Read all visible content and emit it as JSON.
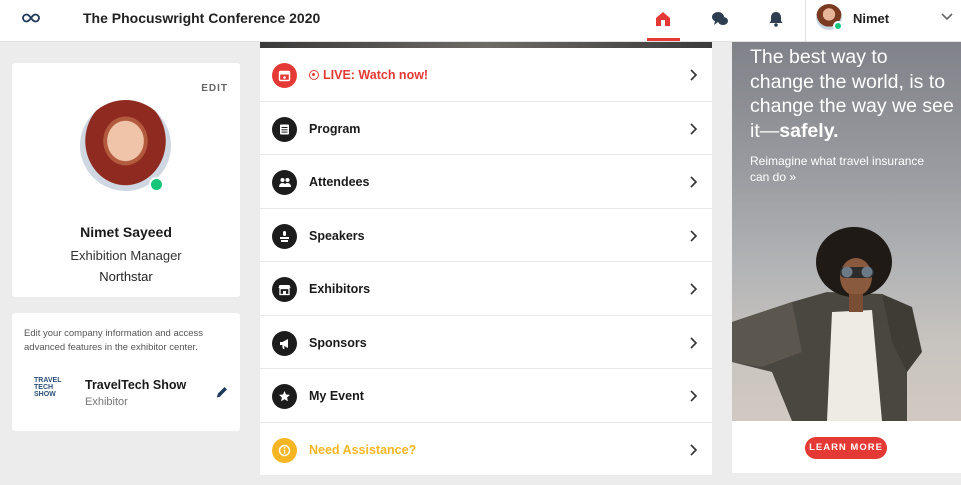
{
  "header": {
    "title": "The Phocuswright Conference 2020",
    "logo_icon": "infinity-logo-icon",
    "nav": [
      {
        "name": "home",
        "icon": "home-icon",
        "active": true
      },
      {
        "name": "chat",
        "icon": "chat-bubbles-icon",
        "active": false
      },
      {
        "name": "notifications",
        "icon": "bell-icon",
        "active": false
      }
    ],
    "user": {
      "name": "Nimet",
      "status": "online"
    },
    "accent_color": "#e53935"
  },
  "profile": {
    "edit_label": "EDIT",
    "name": "Nimet Sayeed",
    "role": "Exhibition Manager",
    "company": "Northstar",
    "status_color": "#16c57a"
  },
  "exhibitor": {
    "note": "Edit your company information and access advanced features in the exhibitor center.",
    "logo_lines": [
      "TRAVEL",
      "TECH",
      "SHOW"
    ],
    "name": "TravelTech Show",
    "type": "Exhibitor"
  },
  "menu": {
    "items": [
      {
        "label": "LIVE: Watch now!",
        "icon": "calendar-live-icon",
        "variant": "live"
      },
      {
        "label": "Program",
        "icon": "schedule-icon",
        "variant": "default"
      },
      {
        "label": "Attendees",
        "icon": "people-icon",
        "variant": "default"
      },
      {
        "label": "Speakers",
        "icon": "podium-icon",
        "variant": "default"
      },
      {
        "label": "Exhibitors",
        "icon": "storefront-icon",
        "variant": "default"
      },
      {
        "label": "Sponsors",
        "icon": "megaphone-icon",
        "variant": "default"
      },
      {
        "label": "My Event",
        "icon": "star-icon",
        "variant": "default"
      },
      {
        "label": "Need Assistance?",
        "icon": "info-icon",
        "variant": "help"
      }
    ]
  },
  "ad": {
    "headline_plain": "The best way to change the world, is to change the way we see it—",
    "headline_bold": "safely.",
    "subtext": "Reimagine what travel insurance can do »",
    "cta": "LEARN MORE"
  }
}
